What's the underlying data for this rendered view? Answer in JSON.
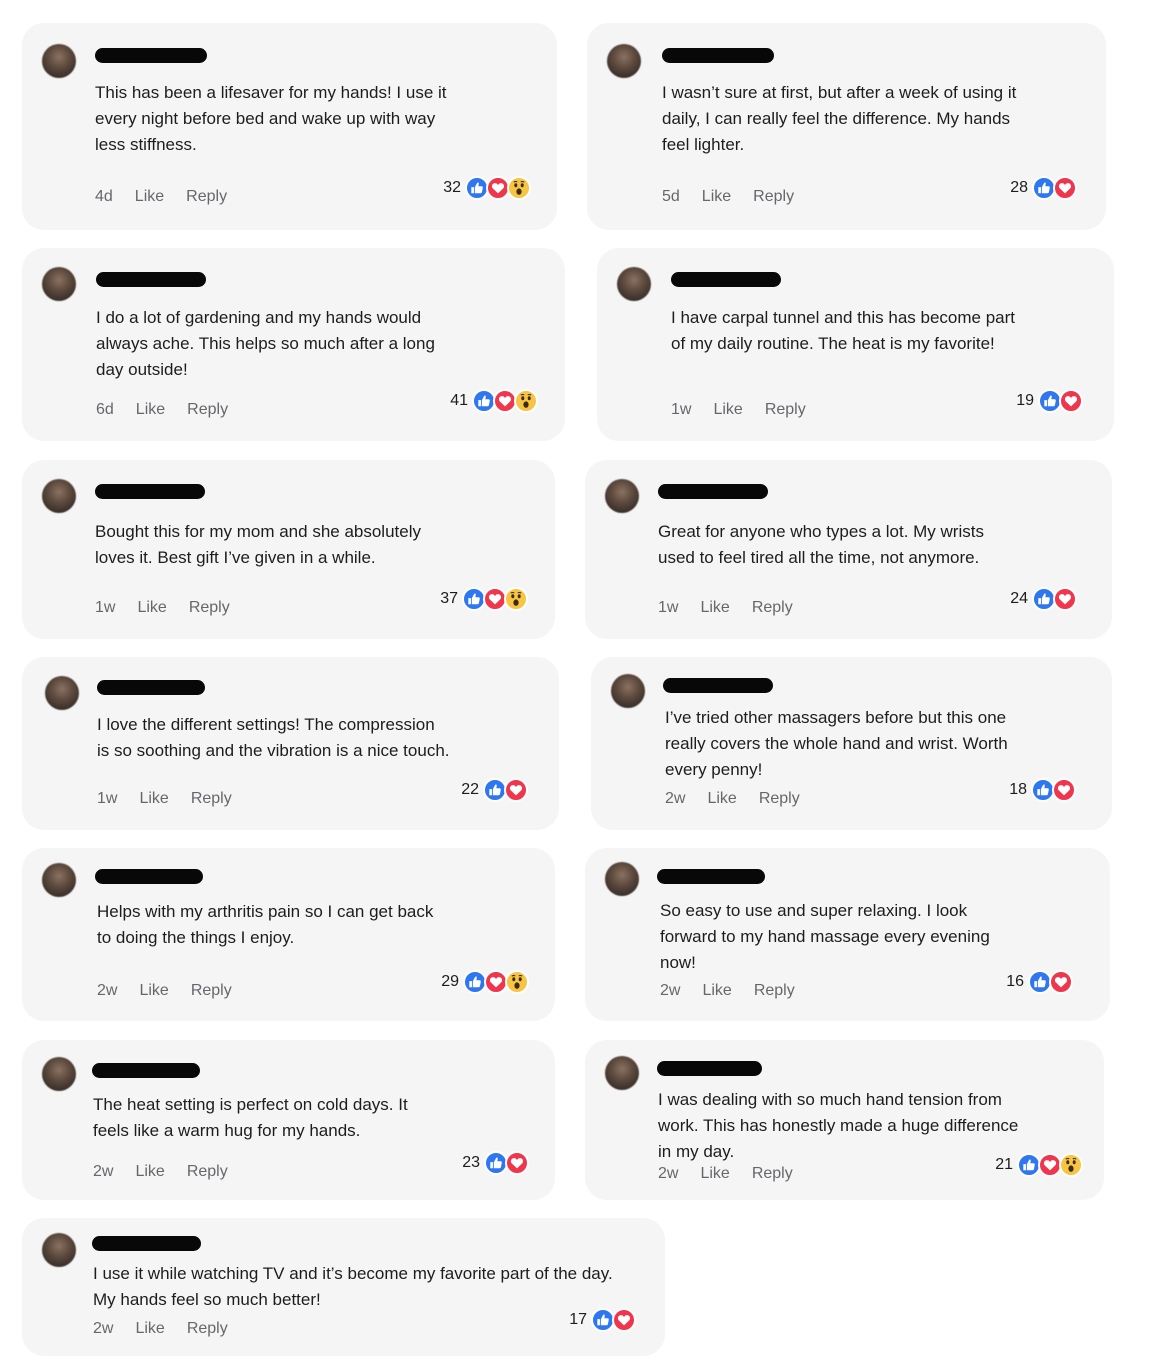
{
  "meta_labels": {
    "like": "Like",
    "reply": "Reply"
  },
  "colors": {
    "like": "#2f77f0",
    "love": "#f0364d",
    "wow": "#f7c444",
    "card_bg": "#f5f5f5"
  },
  "comments": [
    {
      "text": "This has been a lifesaver for my hands! I use it\nevery night before bed and wake up with way\nless stiffness.",
      "time": "4d",
      "count": "32",
      "reactions": [
        "like-icon",
        "love-icon",
        "wow-icon"
      ]
    },
    {
      "text": "I wasn’t sure at first, but after a week of using it\ndaily, I can really feel the difference. My hands\nfeel lighter.",
      "time": "5d",
      "count": "28",
      "reactions": [
        "like-icon",
        "love-icon"
      ]
    },
    {
      "text": "I do a lot of gardening and my hands would\nalways ache. This helps so much after a long\nday outside!",
      "time": "6d",
      "count": "41",
      "reactions": [
        "like-icon",
        "love-icon",
        "wow-icon"
      ]
    },
    {
      "text": "I have carpal tunnel and this has become part\nof my daily routine. The heat is my favorite!",
      "time": "1w",
      "count": "19",
      "reactions": [
        "like-icon",
        "love-icon"
      ]
    },
    {
      "text": "Bought this for my mom and she absolutely\nloves it. Best gift I’ve given in a while.",
      "time": "1w",
      "count": "37",
      "reactions": [
        "like-icon",
        "love-icon",
        "wow-icon"
      ]
    },
    {
      "text": "Great for anyone who types a lot. My wrists\nused to feel tired all the time, not anymore.",
      "time": "1w",
      "count": "24",
      "reactions": [
        "like-icon",
        "love-icon"
      ]
    },
    {
      "text": "I love the different settings! The compression\nis so soothing and the vibration is a nice touch.",
      "time": "1w",
      "count": "22",
      "reactions": [
        "like-icon",
        "love-icon"
      ]
    },
    {
      "text": "I’ve tried other massagers before but this one\nreally covers the whole hand and wrist. Worth\nevery penny!",
      "time": "2w",
      "count": "18",
      "reactions": [
        "like-icon",
        "love-icon"
      ]
    },
    {
      "text": "Helps with my arthritis pain so I can get back\nto doing the things I enjoy.",
      "time": "2w",
      "count": "29",
      "reactions": [
        "like-icon",
        "love-icon",
        "wow-icon"
      ]
    },
    {
      "text": "So easy to use and super relaxing. I look\nforward to my hand massage every evening\nnow!",
      "time": "2w",
      "count": "16",
      "reactions": [
        "like-icon",
        "love-icon"
      ]
    },
    {
      "text": "The heat setting is perfect on cold days. It\nfeels like a warm hug for my hands.",
      "time": "2w",
      "count": "23",
      "reactions": [
        "like-icon",
        "love-icon"
      ]
    },
    {
      "text": "I was dealing with so much hand tension from\nwork. This has honestly made a huge difference\nin my day.",
      "time": "2w",
      "count": "21",
      "reactions": [
        "like-icon",
        "love-icon",
        "wow-icon"
      ]
    },
    {
      "text": "I use it while watching TV and it’s become my favorite part of the day.\nMy hands feel so much better!",
      "time": "2w",
      "count": "17",
      "reactions": [
        "like-icon",
        "love-icon"
      ]
    }
  ]
}
